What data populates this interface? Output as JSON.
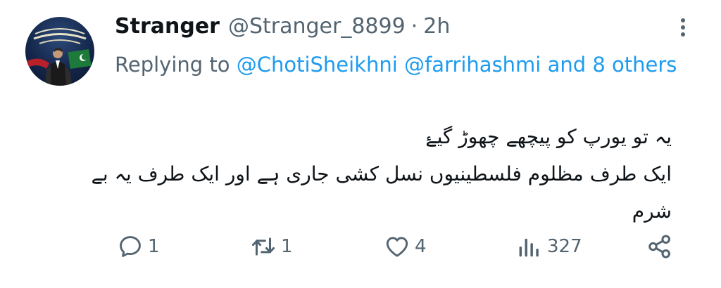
{
  "author": {
    "display_name": "Stranger",
    "handle": "@Stranger_8899",
    "separator": "·",
    "timestamp": "2h"
  },
  "reply": {
    "prefix": "Replying to",
    "mention_1": "@ChotiSheikhni",
    "mention_2": "@farrihashmi",
    "others": "and 8 others"
  },
  "tweet": {
    "lines": [
      "یہ تو یورپ کو پیچھے چھوڑ گیۓ",
      "ایک طرف مظلوم فلسطینیوں نسل کشی جاری ہے اور ایک طرف یہ بے",
      "شرم"
    ]
  },
  "actions": {
    "replies": "1",
    "retweets": "1",
    "likes": "4",
    "views": "327"
  },
  "colors": {
    "text": "#0f1419",
    "secondary": "#536471",
    "link": "#1d9bf0",
    "background": "#ffffff"
  },
  "icons": [
    "more-options-icon",
    "reply-icon",
    "retweet-icon",
    "like-icon",
    "views-icon",
    "share-icon"
  ]
}
